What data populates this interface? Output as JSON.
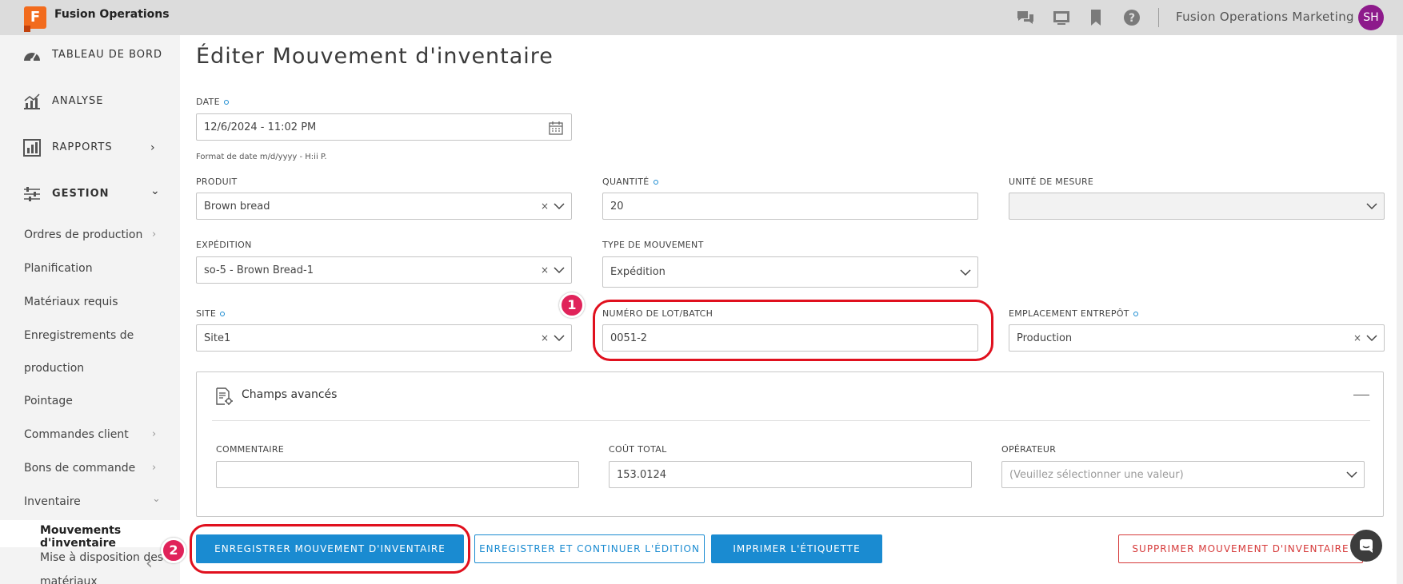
{
  "app": {
    "logo_letter": "F",
    "name": "Fusion Operations",
    "org": "Fusion Operations Marketing",
    "avatar_initials": "SH"
  },
  "sidebar": {
    "main": [
      {
        "label": "TABLEAU DE BORD"
      },
      {
        "label": "ANALYSE"
      },
      {
        "label": "RAPPORTS",
        "arrow": "›"
      },
      {
        "label": "GESTION",
        "arrow": "⌄"
      }
    ],
    "sub": [
      {
        "label": "Ordres de production",
        "arrow": "›"
      },
      {
        "label": "Planification"
      },
      {
        "label": "Matériaux requis"
      },
      {
        "label": "Enregistrements de"
      },
      {
        "label": "production"
      },
      {
        "label": "Pointage"
      },
      {
        "label": "Commandes client",
        "arrow": "›"
      },
      {
        "label": "Bons de commande",
        "arrow": "›"
      },
      {
        "label": "Inventaire",
        "arrow": "⌄"
      }
    ],
    "sub2": [
      {
        "label": "Mouvements d'inventaire"
      },
      {
        "label": "Mise à disposition des"
      },
      {
        "label": "matériaux"
      }
    ],
    "collapse_glyph": "‹"
  },
  "page": {
    "title": "Éditer Mouvement d'inventaire"
  },
  "form": {
    "date": {
      "label": "DATE",
      "value": "12/6/2024 - 11:02 PM",
      "help": "Format de date m/d/yyyy - H:ii P."
    },
    "produit": {
      "label": "PRODUIT",
      "value": "Brown bread",
      "clear": "×"
    },
    "quantite": {
      "label": "QUANTITÉ",
      "value": "20"
    },
    "unite": {
      "label": "UNITÉ DE MESURE",
      "value": ""
    },
    "expedition": {
      "label": "EXPÉDITION",
      "value": "so-5 - Brown Bread-1",
      "clear": "×"
    },
    "type": {
      "label": "TYPE DE MOUVEMENT",
      "value": "Expédition"
    },
    "site": {
      "label": "SITE",
      "value": "Site1",
      "clear": "×"
    },
    "lot": {
      "label": "NUMÉRO DE LOT/BATCH",
      "value": "0051-2"
    },
    "emplacement": {
      "label": "EMPLACEMENT ENTREPÔT",
      "value": "Production",
      "clear": "×"
    }
  },
  "advanced": {
    "title": "Champs avancés",
    "commentaire": {
      "label": "COMMENTAIRE",
      "value": ""
    },
    "cout": {
      "label": "COÛT TOTAL",
      "value": "153.0124"
    },
    "operateur": {
      "label": "OPÉRATEUR",
      "placeholder": "(Veuillez sélectionner une valeur)"
    }
  },
  "buttons": {
    "save": "ENREGISTRER MOUVEMENT D'INVENTAIRE",
    "save_continue": "ENREGISTRER ET CONTINUER L'ÉDITION",
    "print": "IMPRIMER L'ÉTIQUETTE",
    "delete": "SUPPRIMER MOUVEMENT D'INVENTAIRE"
  },
  "annotations": {
    "m1": "1",
    "m2": "2"
  },
  "colors": {
    "accent": "#1a8bd1",
    "highlight": "#e0101e",
    "marker": "#e0235a",
    "avatar": "#8d1a8b",
    "danger": "#d63a3a"
  }
}
